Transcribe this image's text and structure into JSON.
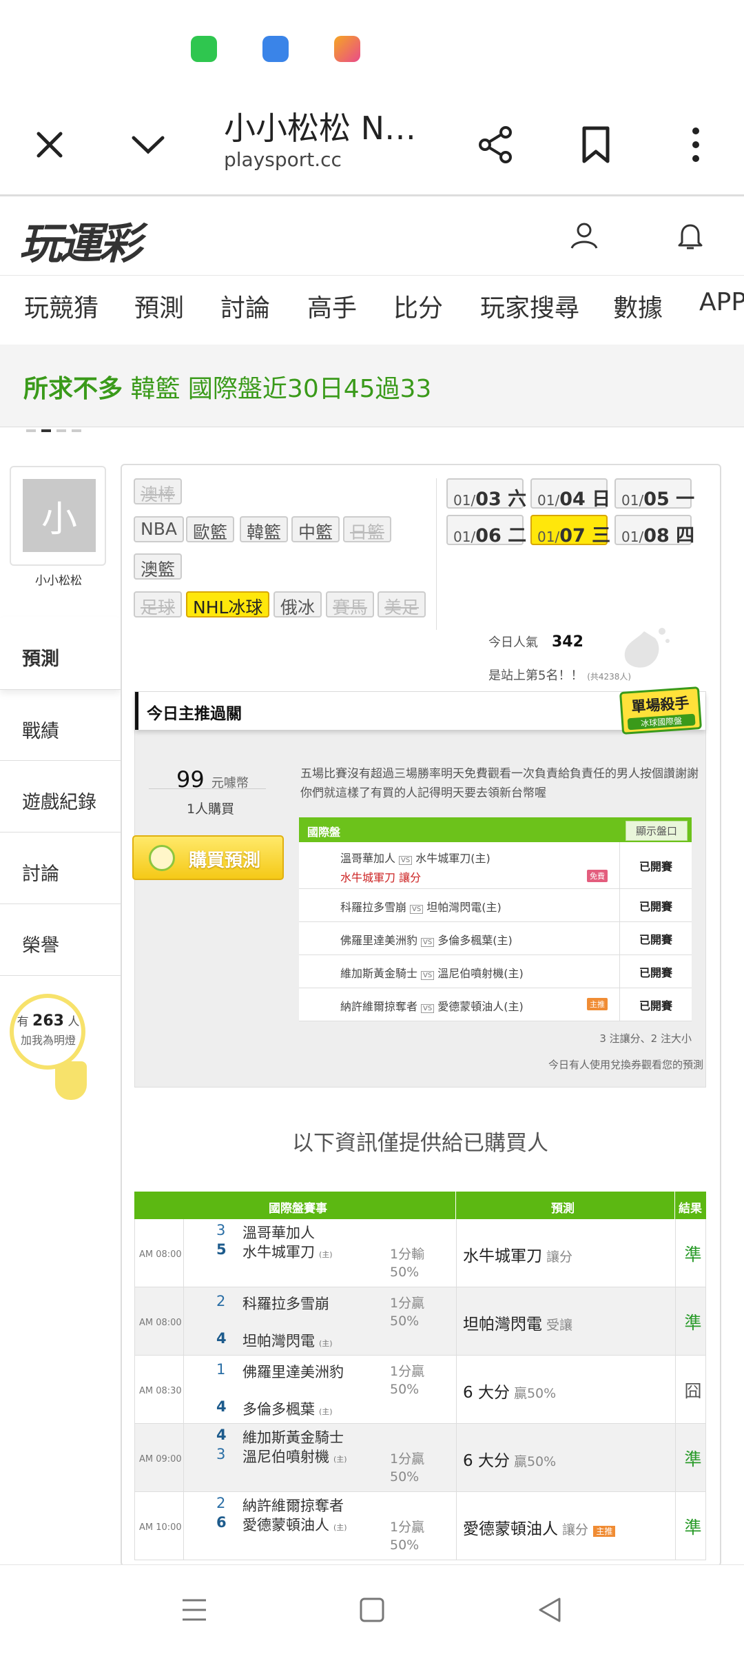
{
  "browser": {
    "title": "小小松松 N…",
    "url": "playsport.cc"
  },
  "site": {
    "logo_text": "玩運彩",
    "nav": [
      "玩競猜",
      "預測",
      "討論",
      "高手",
      "比分",
      "玩家搜尋",
      "數據",
      "APP"
    ]
  },
  "ticker": {
    "text": "所求不多 韓籃 國際盤近30日45過33"
  },
  "profile": {
    "avatar_char": "小",
    "name": "小小松松",
    "menu": [
      "預測",
      "戰績",
      "遊戲紀錄",
      "討論",
      "榮譽"
    ],
    "fans_prefix": "有",
    "fans_count": "263",
    "fans_suffix": "人",
    "fans_text": "加我為明燈"
  },
  "sports": {
    "row1": [
      "澳棒"
    ],
    "row2": [
      "NBA",
      "歐籃",
      "韓籃",
      "中籃",
      "日籃"
    ],
    "row3": [
      "澳籃"
    ],
    "row4": [
      "足球",
      "NHL冰球",
      "俄冰",
      "賽馬",
      "美足"
    ]
  },
  "dates": [
    {
      "mo": "01/",
      "day": "03 六"
    },
    {
      "mo": "01/",
      "day": "04 日"
    },
    {
      "mo": "01/",
      "day": "05 一"
    },
    {
      "mo": "01/",
      "day": "06 二"
    },
    {
      "mo": "01/",
      "day": "07 三"
    },
    {
      "mo": "01/",
      "day": "08 四"
    }
  ],
  "popularity": {
    "label": "今日人氣",
    "value": "342",
    "rank_text": "是站上第5名！！",
    "rank_total": "(共4238人)"
  },
  "pick": {
    "header": "今日主推過關",
    "badge_title": "單場殺手",
    "badge_sub": "冰球國際盤",
    "price": "99",
    "price_unit": "元噱幣",
    "buyers": "1人購買",
    "buy_button": "購買預測",
    "description": "五場比賽沒有超過三場勝率明天免費觀看一次負責給負責任的男人按個讚謝謝你們就這樣了有買的人記得明天要去領新台幣喔",
    "table_header": "國際盤",
    "show_odds_button": "顯示盤口",
    "rows": [
      {
        "away": "溫哥華加人",
        "home": "水牛城軍刀(主)",
        "pick_team": "水牛城軍刀",
        "pick_type": "讓分",
        "chip": "免費",
        "status": "已開賽"
      },
      {
        "away": "科羅拉多雪崩",
        "home": "坦帕灣閃電(主)",
        "pick_team": "",
        "pick_type": "",
        "chip": "",
        "status": "已開賽"
      },
      {
        "away": "佛羅里達美洲豹",
        "home": "多倫多楓葉(主)",
        "pick_team": "",
        "pick_type": "",
        "chip": "",
        "status": "已開賽"
      },
      {
        "away": "維加斯黃金騎士",
        "home": "溫尼伯噴射機(主)",
        "pick_team": "",
        "pick_type": "",
        "chip": "",
        "status": "已開賽"
      },
      {
        "away": "納許維爾掠奪者",
        "home": "愛德蒙頓油人(主)",
        "pick_team": "",
        "pick_type": "",
        "chip": "主推",
        "status": "已開賽"
      }
    ],
    "note1": "3 注讓分、2 注大小",
    "note2": "今日有人使用兌換券觀看您的預測"
  },
  "info_message": "以下資訊僅提供給已購買人",
  "results": {
    "headers": [
      "國際盤賽事",
      "預測",
      "結果"
    ],
    "rows": [
      {
        "time": "AM 08:00",
        "s1": "3",
        "t1": "溫哥華加人",
        "s2": "5",
        "t2": "水牛城軍刀",
        "home_mark": "(主)",
        "odds1": "1分輸",
        "odds2": "50%",
        "pred": "水牛城軍刀",
        "pred_type": "讓分",
        "res": "準"
      },
      {
        "time": "AM 08:00",
        "s1": "2",
        "t1": "科羅拉多雪崩",
        "s2": "4",
        "t2": "坦帕灣閃電",
        "home_mark": "(主)",
        "odds1": "1分贏",
        "odds2": "50%",
        "pred": "坦帕灣閃電",
        "pred_type": "受讓",
        "res": "準"
      },
      {
        "time": "AM 08:30",
        "s1": "1",
        "t1": "佛羅里達美洲豹",
        "s2": "4",
        "t2": "多倫多楓葉",
        "home_mark": "(主)",
        "odds1": "1分贏",
        "odds2": "50%",
        "pred": "6 大分",
        "pred_type": "贏50%",
        "res": "囧"
      },
      {
        "time": "AM 09:00",
        "s1": "4",
        "t1": "維加斯黃金騎士",
        "s2": "3",
        "t2": "溫尼伯噴射機",
        "home_mark": "(主)",
        "odds1": "1分贏",
        "odds2": "50%",
        "pred": "6 大分",
        "pred_type": "贏50%",
        "res": "準"
      },
      {
        "time": "AM 10:00",
        "s1": "2",
        "t1": "納許維爾掠奪者",
        "s2": "6",
        "t2": "愛德蒙頓油人",
        "home_mark": "(主)",
        "odds1": "1分贏",
        "odds2": "50%",
        "pred": "愛德蒙頓油人",
        "pred_type": "讓分",
        "res": "準"
      }
    ],
    "main_chip": "主推"
  },
  "colors": {
    "accent_green": "#5cb812",
    "highlight_yellow": "#ffe70b",
    "ticker_green": "#3a9a1a"
  }
}
